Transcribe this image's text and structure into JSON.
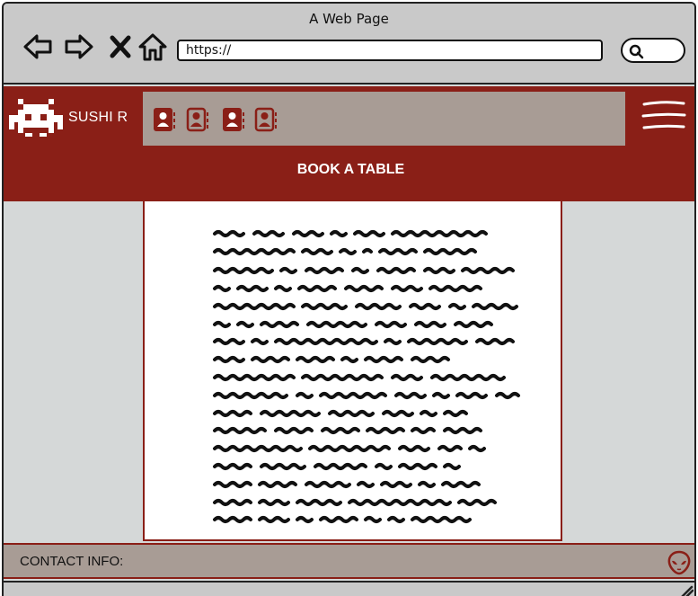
{
  "window": {
    "title": "A Web Page"
  },
  "toolbar": {
    "back_icon": "back-arrow-icon",
    "forward_icon": "forward-arrow-icon",
    "stop_icon": "close-icon",
    "home_icon": "home-icon",
    "url": "https://",
    "search_icon": "search-icon"
  },
  "header": {
    "logo_icon": "space-invader-icon",
    "brand": "SUSHI R",
    "nav_icons": [
      "contact-card-icon",
      "contact-card-icon",
      "contact-card-icon",
      "contact-card-icon"
    ],
    "menu_icon": "hamburger-menu-icon",
    "cta_label": "BOOK A TABLE"
  },
  "content": {
    "placeholder": "scribbled-text-placeholder"
  },
  "footer": {
    "label": "CONTACT INFO:",
    "icon": "alien-icon"
  },
  "colors": {
    "brand_red": "#8a1f17",
    "nav_gray": "#a89c95",
    "page_bg": "#d5d8d8",
    "chrome_gray": "#c9c9c9"
  }
}
